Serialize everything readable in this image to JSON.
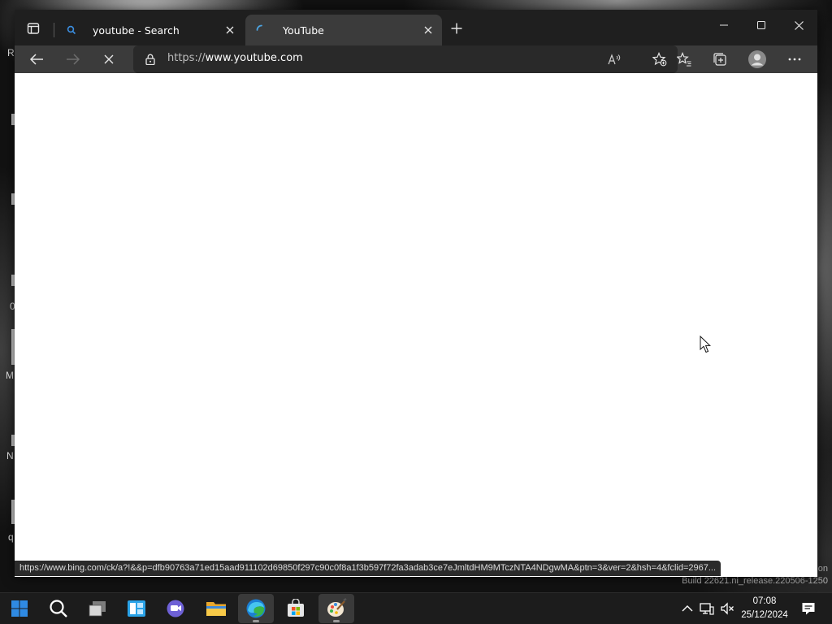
{
  "desktop": {
    "icon_fragments": [
      "R",
      "0",
      "M",
      "N",
      "q",
      "on"
    ],
    "watermark": "Build 22621.ni_release.220506-1250"
  },
  "browser": {
    "tabs": [
      {
        "title": "youtube - Search",
        "favicon": "search-icon",
        "active": false
      },
      {
        "title": "YouTube",
        "favicon": "loading-spinner-icon",
        "active": true
      }
    ],
    "address": {
      "scheme": "https://",
      "host": "www.youtube.com"
    },
    "status_url": "https://www.bing.com/ck/a?!&&p=dfb90763a71ed15aad911102d69850f297c90c0f8a1f3b597f72fa3adab3ce7eJmltdHM9MTczNTA4NDgwMA&ptn=3&ver=2&hsh=4&fclid=2967...",
    "colors": {
      "titlebar": "#1f1f1f",
      "toolbar": "#3b3b3b",
      "omnibox": "#292929",
      "spinner": "#4ca3e0"
    }
  },
  "taskbar": {
    "apps": [
      "start-icon",
      "search-icon",
      "task-view-icon",
      "widgets-icon",
      "chat-icon",
      "file-explorer-icon",
      "edge-icon",
      "store-icon",
      "paint-icon"
    ],
    "active_app": "edge-icon",
    "clock": {
      "time": "07:08",
      "date": "25/12/2024"
    }
  }
}
